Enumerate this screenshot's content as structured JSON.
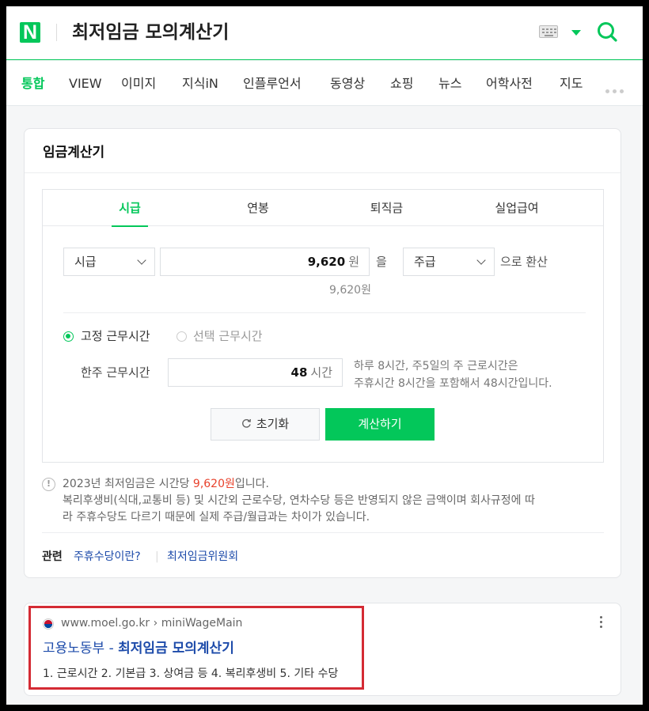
{
  "header": {
    "logo": "N",
    "query": "최저임금 모의계산기"
  },
  "nav_tabs": [
    "통합",
    "VIEW",
    "이미지",
    "지식iN",
    "인플루언서",
    "동영상",
    "쇼핑",
    "뉴스",
    "어학사전",
    "지도"
  ],
  "card": {
    "title": "임금계산기",
    "calc_tabs": [
      "시급",
      "연봉",
      "퇴직금",
      "실업급여"
    ],
    "from_select": "시급",
    "amount": "9,620",
    "amount_unit": "원",
    "particle": "을",
    "to_select": "주급",
    "convert_suffix": "으로 환산",
    "amount_readout": "9,620원",
    "radio_fixed": "고정 근무시간",
    "radio_select": "선택 근무시간",
    "weekly_label": "한주 근무시간",
    "weekly_hours": "48",
    "weekly_unit": "시간",
    "hours_note_1": "하루 8시간, 주5일의 주 근로시간은",
    "hours_note_2": "주휴시간 8시간을 포함해서 48시간입니다.",
    "reset_label": "초기화",
    "calc_label": "계산하기",
    "notice_pre": "2023년 최저임금은 시간당 ",
    "notice_wage": "9,620원",
    "notice_post": "입니다.",
    "notice_line2": "복리후생비(식대,교통비 등) 및 시간외 근로수당, 연차수당 등은 반영되지 않은 금액이며 회사규정에 따",
    "notice_line3": "라 주휴수당도 다르기 때문에 실제 주급/월급과는 차이가 있습니다.",
    "related_label": "관련",
    "related_links": [
      "주휴수당이란?",
      "최저임금위원회"
    ]
  },
  "result": {
    "url": "www.moel.go.kr › miniWageMain",
    "title_pre": "고용노동부 - ",
    "title_bold": "최저임금 모의계산기",
    "desc": "1. 근로시간 2. 기본급 3. 상여금 등 4. 복리후생비 5. 기타 수당"
  },
  "colors": {
    "brand": "#03c75a",
    "link": "#1d4baa",
    "highlight": "#d42b34",
    "wage": "#e8412b"
  }
}
